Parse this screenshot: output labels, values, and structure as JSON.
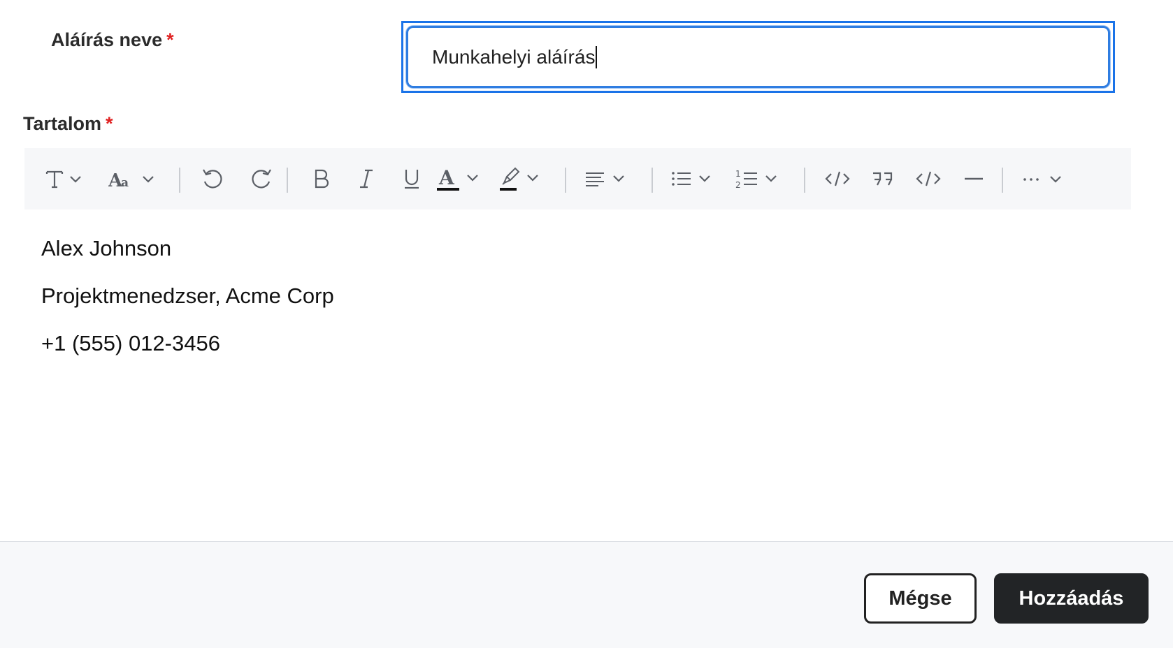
{
  "form": {
    "name_label": "Aláírás neve",
    "name_required_mark": "*",
    "name_value": "Munkahelyi aláírás",
    "content_label": "Tartalom",
    "content_required_mark": "*"
  },
  "toolbar": {
    "items": [
      {
        "name": "text-style-icon"
      },
      {
        "name": "font-size-icon"
      },
      {
        "name": "undo-icon"
      },
      {
        "name": "redo-icon"
      },
      {
        "name": "bold-icon"
      },
      {
        "name": "italic-icon"
      },
      {
        "name": "underline-icon"
      },
      {
        "name": "text-color-icon"
      },
      {
        "name": "highlight-color-icon"
      },
      {
        "name": "align-icon"
      },
      {
        "name": "bulleted-list-icon"
      },
      {
        "name": "numbered-list-icon"
      },
      {
        "name": "code-icon"
      },
      {
        "name": "blockquote-icon"
      },
      {
        "name": "source-code-icon"
      },
      {
        "name": "horizontal-line-icon"
      },
      {
        "name": "more-options-icon"
      }
    ]
  },
  "editor": {
    "lines": [
      "Alex Johnson",
      "Projektmenedzser, Acme Corp",
      "+1 (555) 012-3456"
    ]
  },
  "footer": {
    "cancel_label": "Mégse",
    "add_label": "Hozzáadás"
  },
  "colors": {
    "focus_blue": "#1a73e8",
    "required_red": "#e02020",
    "primary_button": "#222426"
  }
}
